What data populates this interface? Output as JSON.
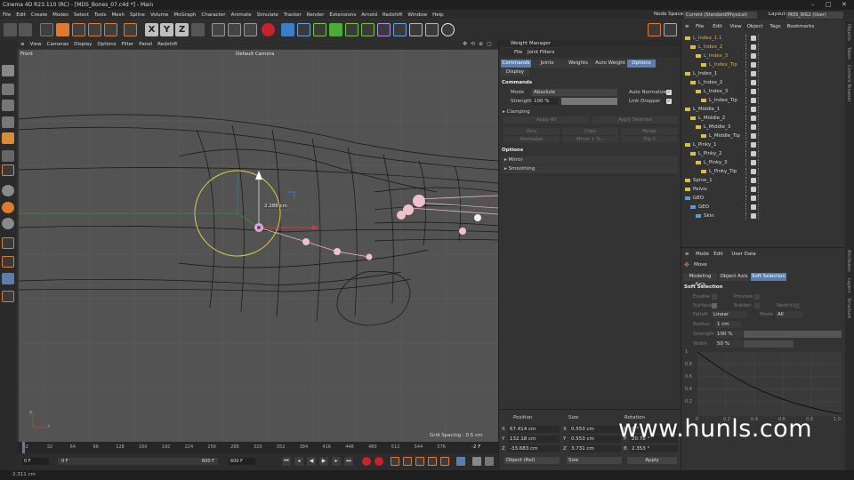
{
  "window": {
    "title": "Cinema 4D R23.110 (RC) - [MDS_Bones_07.c4d *] - Main"
  },
  "menubar": {
    "items": [
      "File",
      "Edit",
      "Create",
      "Modes",
      "Select",
      "Tools",
      "Mesh",
      "Spline",
      "Volume",
      "MoGraph",
      "Character",
      "Animate",
      "Simulate",
      "Tracker",
      "Render",
      "Extensions",
      "Arnold",
      "Redshift",
      "Window",
      "Help"
    ],
    "node_space_label": "Node Space:",
    "node_space_value": "Current (Standard/Physical)",
    "layout_label": "Layout:",
    "layout_value": "MDS_RIG2 (User)"
  },
  "toolbar": {
    "axis_x": "X",
    "axis_y": "Y",
    "axis_z": "Z"
  },
  "viewport_menu": {
    "items": [
      "View",
      "Cameras",
      "Display",
      "Options",
      "Filter",
      "Panel",
      "Redshift"
    ]
  },
  "viewport": {
    "view_name": "Front",
    "camera": "Default Camera",
    "measure": "2.288 cm",
    "grid_spacing": "Grid Spacing : 0.5 cm",
    "axis_y": "y",
    "axis_x": "x"
  },
  "timeline": {
    "ticks": [
      "-2",
      "32",
      "64",
      "96",
      "128",
      "160",
      "192",
      "224",
      "256",
      "288",
      "320",
      "352",
      "384",
      "416",
      "448",
      "480",
      "512",
      "544",
      "576"
    ],
    "current": "-2 F"
  },
  "transport": {
    "start": "0 F",
    "preview_start": "0 F",
    "preview_end": "600 F",
    "end": "600 F"
  },
  "weight_manager": {
    "title": "Weight Manager",
    "menu": [
      "File",
      "Joint Filters"
    ],
    "tabs": [
      "Commands",
      "Joints",
      "Weights",
      "Auto Weight",
      "Options"
    ],
    "sub_tab": "Display",
    "commands_header": "Commands",
    "mode_label": "Mode",
    "mode_value": "Absolute",
    "auto_normalize": "Auto Normalize",
    "strength_label": "Strength",
    "strength_value": "100 %",
    "link_dropper": "Link Dropper",
    "clamping": "Clamping",
    "apply_all": "Apply All",
    "apply_selected": "Apply Selected",
    "zero": "Zero",
    "copy": "Copy",
    "merge": "Merge",
    "normalize": "Normalize",
    "mirror_btn": "Mirror + To -",
    "flip": "Flip X",
    "options_header": "Options",
    "mirror": "Mirror",
    "smoothing": "Smoothing"
  },
  "coordinates": {
    "position_label": "Position",
    "size_label": "Size",
    "rotation_label": "Rotation",
    "rows": [
      {
        "axis": "X",
        "pos": "67.414 cm",
        "size_axis": "X",
        "size": "0.553 cm",
        "rot_axis": "H",
        "rot": "0 °"
      },
      {
        "axis": "Y",
        "pos": "132.18 cm",
        "size_axis": "Y",
        "size": "0.553 cm",
        "rot_axis": "P",
        "rot": "20.78 °"
      },
      {
        "axis": "Z",
        "pos": "-33.683 cm",
        "size_axis": "Z",
        "size": "3.731 cm",
        "rot_axis": "B",
        "rot": "2.353 °"
      }
    ],
    "mode": "Object (Rel)",
    "size_mode": "Size",
    "apply": "Apply"
  },
  "object_manager": {
    "menu": [
      "File",
      "Edit",
      "View",
      "Object",
      "Tags",
      "Bookmarks"
    ],
    "objects": [
      {
        "name": "L_Index_1.1",
        "level": 0,
        "color": "#d9b040"
      },
      {
        "name": "L_Index_2",
        "level": 1,
        "color": "#d9b040"
      },
      {
        "name": "L_Index_3",
        "level": 2,
        "color": "#d9b040"
      },
      {
        "name": "L_Index_Tip",
        "level": 3,
        "color": "#d9b040"
      },
      {
        "name": "L_Index_1",
        "level": 0,
        "color": "#dddddd"
      },
      {
        "name": "L_Index_2",
        "level": 1,
        "color": "#dddddd"
      },
      {
        "name": "L_Index_3",
        "level": 2,
        "color": "#dddddd"
      },
      {
        "name": "L_Index_Tip",
        "level": 3,
        "color": "#dddddd"
      },
      {
        "name": "L_Middle_1",
        "level": 0,
        "color": "#dddddd"
      },
      {
        "name": "L_Middle_2",
        "level": 1,
        "color": "#dddddd"
      },
      {
        "name": "L_Middle_3",
        "level": 2,
        "color": "#dddddd"
      },
      {
        "name": "L_Middle_Tip",
        "level": 3,
        "color": "#dddddd"
      },
      {
        "name": "L_Pinky_1",
        "level": 0,
        "color": "#dddddd"
      },
      {
        "name": "L_Pinky_2",
        "level": 1,
        "color": "#dddddd"
      },
      {
        "name": "L_Pinky_3",
        "level": 2,
        "color": "#dddddd"
      },
      {
        "name": "L_Pinky_Tip",
        "level": 3,
        "color": "#dddddd"
      },
      {
        "name": "Spine_1",
        "level": 0,
        "color": "#dddddd"
      },
      {
        "name": "Pelvis",
        "level": 0,
        "color": "#dddddd"
      },
      {
        "name": "GEO",
        "level": 0,
        "color": "#dddddd"
      },
      {
        "name": "GEO",
        "level": 1,
        "color": "#dddddd"
      },
      {
        "name": "Skin",
        "level": 2,
        "color": "#dddddd"
      }
    ]
  },
  "attribute_manager": {
    "menu": [
      "Mode",
      "Edit",
      "User Data"
    ],
    "tool": "Move",
    "tabs": [
      "Modeling Axis",
      "Object Axis",
      "Soft Selection"
    ],
    "section": "Soft Selection",
    "enable": "Enable",
    "preview": "Preview",
    "surface": "Surface",
    "rubber": "Rubber",
    "restrict": "Restrict",
    "falloff_label": "Falloff",
    "falloff_value": "Linear",
    "mode_label": "Mode",
    "mode_value": "All",
    "radius_label": "Radius",
    "radius_value": "1 cm",
    "strength_label": "Strength",
    "strength_value": "100 %",
    "width_label": "Width",
    "width_value": "50 %",
    "graph_y": [
      "1",
      "0.8",
      "0.6",
      "0.4",
      "0.2"
    ],
    "graph_x": [
      "0",
      "0.2",
      "0.4",
      "0.6",
      "0.8",
      "1.0"
    ]
  },
  "right_tabs": [
    "Objects",
    "Takes",
    "Content Browser",
    "Attributes",
    "Layers",
    "Structure"
  ],
  "status": {
    "text": "2.311 cm"
  },
  "watermark": "www.hunls.com"
}
